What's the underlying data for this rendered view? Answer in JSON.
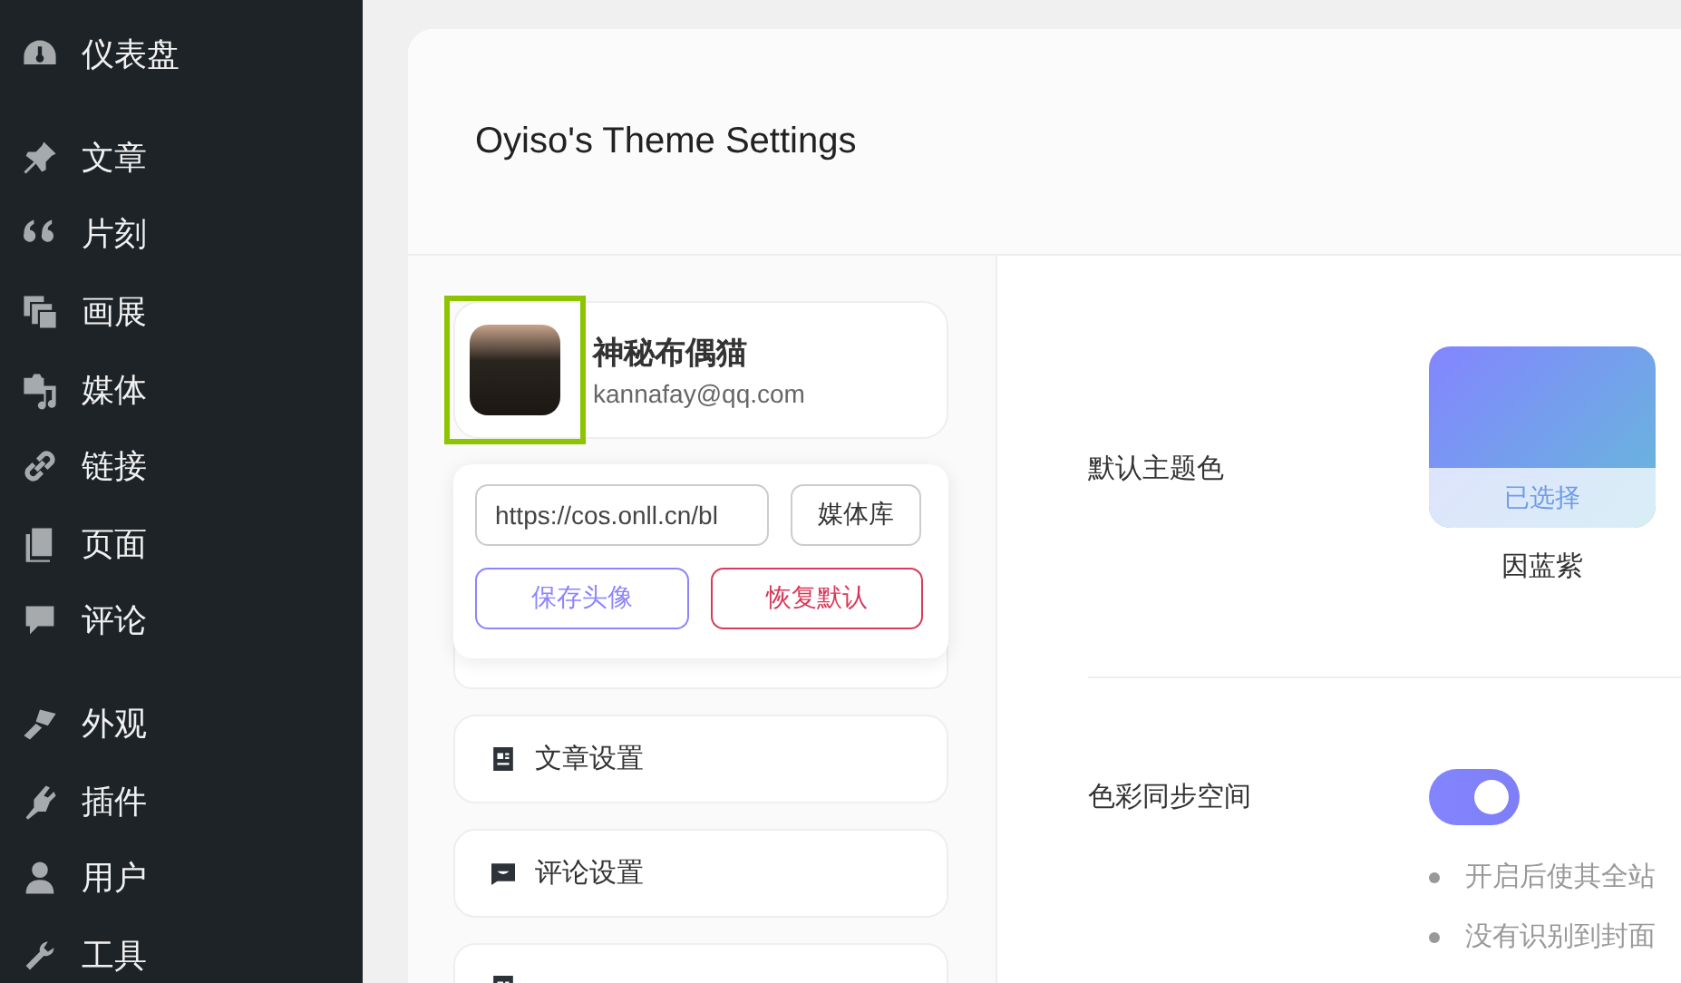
{
  "sidebar": {
    "groups": [
      [
        {
          "label": "仪表盘",
          "kind": "gauge"
        }
      ],
      [
        {
          "label": "文章",
          "kind": "pin"
        },
        {
          "label": "片刻",
          "kind": "quote"
        },
        {
          "label": "画展",
          "kind": "gallery"
        },
        {
          "label": "媒体",
          "kind": "media"
        },
        {
          "label": "链接",
          "kind": "link"
        },
        {
          "label": "页面",
          "kind": "pages"
        },
        {
          "label": "评论",
          "kind": "comment"
        }
      ],
      [
        {
          "label": "外观",
          "kind": "brush"
        },
        {
          "label": "插件",
          "kind": "plug"
        },
        {
          "label": "用户",
          "kind": "user"
        },
        {
          "label": "工具",
          "kind": "wrench"
        }
      ]
    ]
  },
  "header": {
    "title": "Oyiso's Theme Settings"
  },
  "profile": {
    "name": "神秘布偶猫",
    "email": "kannafay@qq.com",
    "highlighted": true
  },
  "avatar_popup": {
    "url": "https://cos.onll.cn/bl",
    "media_button": "媒体库",
    "save_button": "保存头像",
    "reset_button": "恢复默认"
  },
  "menu": [
    {
      "label": "文章设置",
      "kind": "doc"
    },
    {
      "label": "评论设置",
      "kind": "comment"
    },
    {
      "kind": "doc"
    }
  ],
  "settings": {
    "theme_color": {
      "label": "默认主题色",
      "swatches": [
        {
          "name": "因蓝紫",
          "selected": true,
          "badge": "已选择"
        }
      ]
    },
    "color_sync": {
      "label": "色彩同步空间",
      "on": true,
      "notes": [
        "开启后使其全站",
        "没有识别到封面"
      ]
    }
  }
}
